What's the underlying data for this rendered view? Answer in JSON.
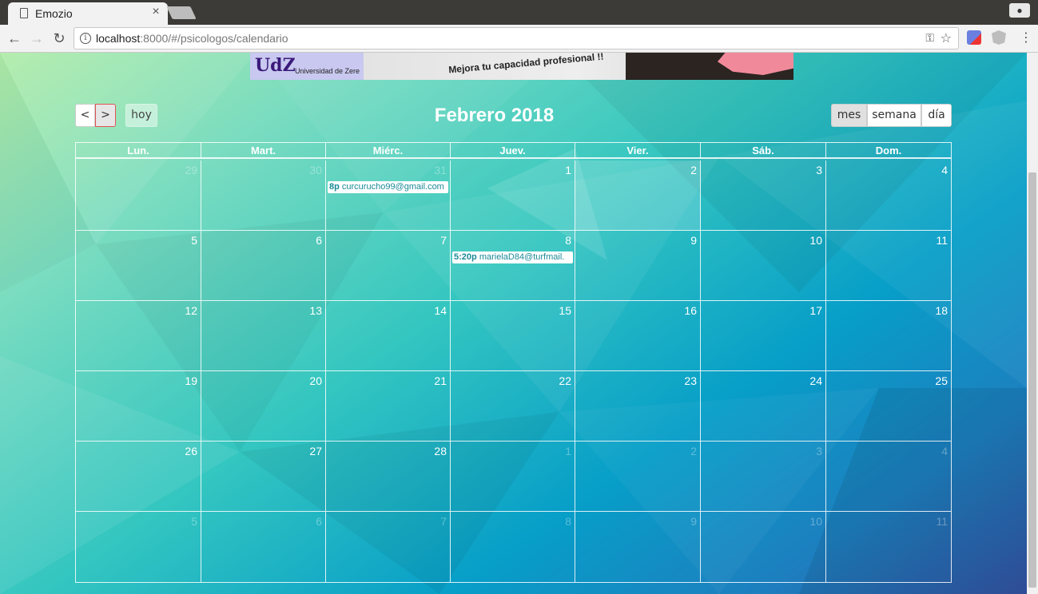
{
  "browser": {
    "tab_title": "Emozio",
    "tab_close": "×",
    "url_host": "localhost",
    "url_rest": ":8000/#/psicologos/calendario",
    "back": "←",
    "forward": "→",
    "reload": "↻",
    "info": "i",
    "key": "⚿",
    "star": "☆",
    "menu": "⋮",
    "profile": "●"
  },
  "banner": {
    "logo": "UdZ",
    "subtitle": "Universidad de Zere",
    "slogan": "Mejora tu capacidad profesional !!"
  },
  "calendar": {
    "title": "Febrero 2018",
    "prev_label": "<",
    "next_label": ">",
    "today_label": "hoy",
    "views": {
      "month": "mes",
      "week": "semana",
      "day": "día"
    },
    "weekdays": [
      "Lun.",
      "Mart.",
      "Miérc.",
      "Juev.",
      "Vier.",
      "Sáb.",
      "Dom."
    ],
    "weeks": [
      [
        "29",
        "30",
        "31",
        "1",
        "2",
        "3",
        "4"
      ],
      [
        "5",
        "6",
        "7",
        "8",
        "9",
        "10",
        "11"
      ],
      [
        "12",
        "13",
        "14",
        "15",
        "16",
        "17",
        "18"
      ],
      [
        "19",
        "20",
        "21",
        "22",
        "23",
        "24",
        "25"
      ],
      [
        "26",
        "27",
        "28",
        "1",
        "2",
        "3",
        "4"
      ],
      [
        "5",
        "6",
        "7",
        "8",
        "9",
        "10",
        "11"
      ]
    ],
    "events": [
      {
        "week": 0,
        "day": 2,
        "time": "8p",
        "title": "curcurucho99@gmail.com"
      },
      {
        "week": 1,
        "day": 3,
        "time": "5:20p",
        "title": "marielaD84@turfmail."
      }
    ]
  },
  "colors": {
    "accent": "#1a8a98",
    "gradient_start": "#b0eca8",
    "gradient_end": "#3353a3"
  }
}
